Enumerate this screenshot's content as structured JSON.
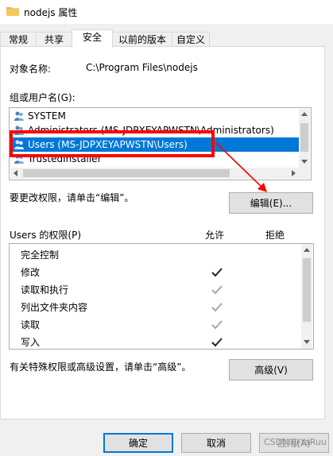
{
  "window": {
    "title": "nodejs 属性"
  },
  "tabs": [
    {
      "label": "常规"
    },
    {
      "label": "共享"
    },
    {
      "label": "安全"
    },
    {
      "label": "以前的版本"
    },
    {
      "label": "自定义"
    }
  ],
  "security": {
    "object_name_label": "对象名称:",
    "object_name_value": "C:\\Program Files\\nodejs",
    "groups_label": "组或用户名(G):",
    "groups": [
      {
        "name": "SYSTEM"
      },
      {
        "name": "Administrators (MS-JDPXEYAPWSTN\\Administrators)"
      },
      {
        "name": "Users (MS-JDPXEYAPWSTN\\Users)"
      },
      {
        "name": "TrustedInstaller"
      }
    ],
    "selected_group_index": 2,
    "change_hint": "要更改权限，请单击“编辑”。",
    "edit_button": "编辑(E)...",
    "perm_header": "Users 的权限(P)",
    "allow_header": "允许",
    "deny_header": "拒绝",
    "permissions": [
      {
        "name": "完全控制",
        "allow": "none"
      },
      {
        "name": "修改",
        "allow": "checked"
      },
      {
        "name": "读取和执行",
        "allow": "grayed"
      },
      {
        "name": "列出文件夹内容",
        "allow": "grayed"
      },
      {
        "name": "读取",
        "allow": "grayed"
      },
      {
        "name": "写入",
        "allow": "checked"
      }
    ],
    "advanced_hint": "有关特殊权限或高级设置，请单击“高级”。",
    "advanced_button": "高级(V)"
  },
  "footer": {
    "ok": "确定",
    "cancel": "取消",
    "apply": "应用(A)"
  },
  "watermark": "CSDN @YaRuu",
  "colors": {
    "selection": "#0078d7",
    "annotation": "#ff0000"
  }
}
